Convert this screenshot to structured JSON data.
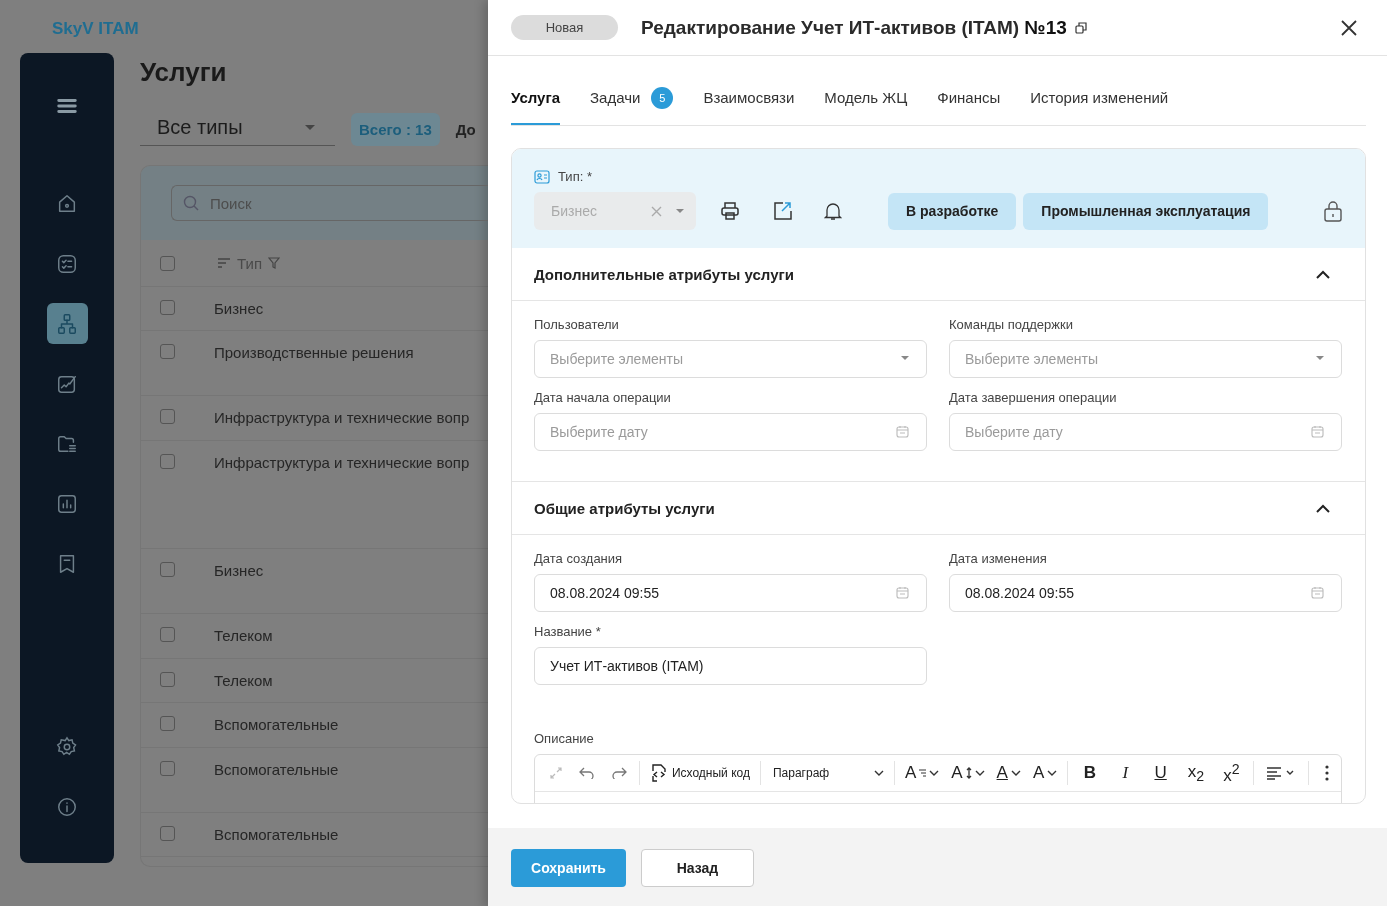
{
  "app": {
    "logo": "SkyV ITAM"
  },
  "sidebar": {
    "items": [
      {
        "kind": "menu",
        "selected": false
      },
      {
        "kind": "home",
        "selected": false
      },
      {
        "kind": "tasks",
        "selected": false
      },
      {
        "kind": "structure",
        "selected": true
      },
      {
        "kind": "signature",
        "selected": false
      },
      {
        "kind": "folder",
        "selected": false
      },
      {
        "kind": "chart",
        "selected": false
      },
      {
        "kind": "bookmark",
        "selected": false
      },
      {
        "kind": "settings",
        "selected": false
      },
      {
        "kind": "info",
        "selected": false
      }
    ]
  },
  "page": {
    "title": "Услуги",
    "type_filter": "Все типы",
    "total": "Всего : 13",
    "next_label": "До",
    "search": {
      "placeholder": "Поиск"
    },
    "table": {
      "columns": [
        "Тип"
      ],
      "select_all_checked": false,
      "rows": [
        {
          "type": "Бизнес",
          "checked": false
        },
        {
          "type": "Производственные решения",
          "checked": false
        },
        {
          "type": "Инфраструктура и технические вопр",
          "checked": false
        },
        {
          "type": "Инфраструктура и технические вопр",
          "checked": false
        },
        {
          "type": "Бизнес",
          "checked": false
        },
        {
          "type": "Телеком",
          "checked": false
        },
        {
          "type": "Телеком",
          "checked": false
        },
        {
          "type": "Вспомогательные",
          "checked": false
        },
        {
          "type": "Вспомогательные",
          "checked": false
        },
        {
          "type": "Вспомогательные",
          "checked": false
        }
      ]
    }
  },
  "drawer": {
    "status": "Новая",
    "title": "Редактирование Учет ИТ-активов (ITAM)",
    "number": "№13",
    "tabs": [
      {
        "label": "Услуга",
        "selected": true
      },
      {
        "label": "Задачи",
        "selected": false,
        "count": "5"
      },
      {
        "label": "Взаимосвязи",
        "selected": false
      },
      {
        "label": "Модель ЖЦ",
        "selected": false
      },
      {
        "label": "Финансы",
        "selected": false
      },
      {
        "label": "История изменений",
        "selected": false
      }
    ],
    "type_field": {
      "label": "Тип: *",
      "value": "Бизнес",
      "disabled": true
    },
    "lifecycle_buttons": [
      "В разработке",
      "Промышленная эксплуатация"
    ],
    "sections": [
      {
        "title": "Дополнительные атрибуты услуги",
        "expanded": true,
        "fields": [
          {
            "label": "Пользователи",
            "kind": "select",
            "placeholder": "Выберите элементы"
          },
          {
            "label": "Команды поддержки",
            "kind": "select",
            "placeholder": "Выберите элементы"
          },
          {
            "label": "Дата начала операции",
            "kind": "date",
            "placeholder": "Выберите дату"
          },
          {
            "label": "Дата завершения операции",
            "kind": "date",
            "placeholder": "Выберите дату"
          }
        ]
      },
      {
        "title": "Общие атрибуты услуги",
        "expanded": true,
        "fields": [
          {
            "label": "Дата создания",
            "kind": "date",
            "value": "08.08.2024 09:55"
          },
          {
            "label": "Дата изменения",
            "kind": "date",
            "value": "08.08.2024 09:55"
          },
          {
            "label": "Название *",
            "kind": "text",
            "value": "Учет ИТ-активов (ITAM)"
          }
        ]
      }
    ],
    "description": {
      "label": "Описание",
      "toolbar": {
        "source_code": "Исходный код",
        "block_format": "Параграф",
        "font_menus": [
          {
            "label": "A",
            "kind": "font-family"
          },
          {
            "label": "A",
            "kind": "font-size"
          },
          {
            "label": "A",
            "kind": "text-color"
          },
          {
            "label": "A",
            "kind": "background-color"
          }
        ],
        "format_buttons": [
          {
            "label": "B",
            "kind": "bold"
          },
          {
            "label": "I",
            "kind": "italic"
          },
          {
            "label": "U",
            "kind": "underline"
          },
          {
            "label": "x$_{2}$",
            "kind": "subscript"
          },
          {
            "label": "x$^{2}$",
            "kind": "superscript"
          }
        ]
      }
    },
    "footer": {
      "save": "Сохранить",
      "back": "Назад"
    }
  }
}
